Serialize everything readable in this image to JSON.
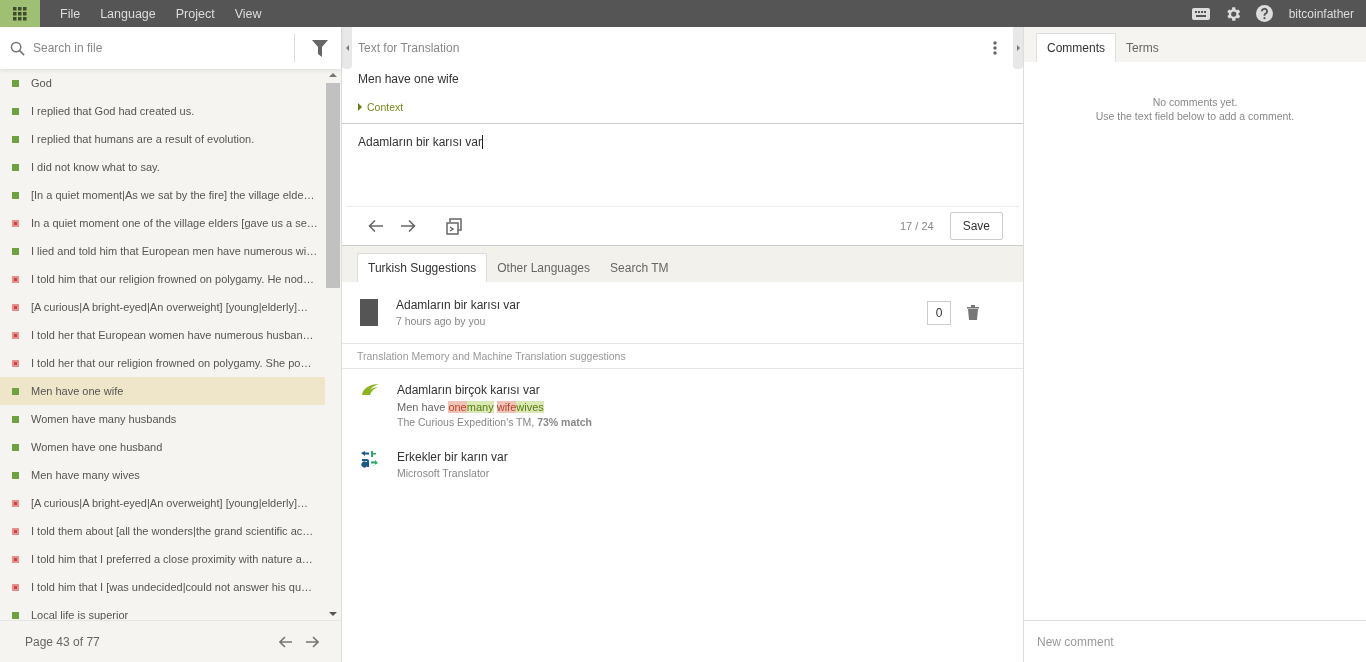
{
  "menu": [
    "File",
    "Language",
    "Project",
    "View"
  ],
  "user": "bitcoinfather",
  "search": {
    "placeholder": "Search in file"
  },
  "strings": [
    {
      "text": "God",
      "translated": true,
      "selected": false
    },
    {
      "text": "I replied that God had created us.",
      "translated": true,
      "selected": false
    },
    {
      "text": "I replied that humans are a result of evolution.",
      "translated": true,
      "selected": false
    },
    {
      "text": "I did not know what to say.",
      "translated": true,
      "selected": false
    },
    {
      "text": "[In a quiet moment|As we sat by the fire] the village elde…",
      "translated": true,
      "selected": false
    },
    {
      "text": "In a quiet moment one of the village elders [gave us a se…",
      "translated": false,
      "selected": false
    },
    {
      "text": "I lied and told him that European men have numerous wi…",
      "translated": true,
      "selected": false
    },
    {
      "text": "I told him that our religion frowned on polygamy. He nod…",
      "translated": false,
      "selected": false
    },
    {
      "text": "[A curious|A bright-eyed|An overweight] [young|elderly]…",
      "translated": false,
      "selected": false
    },
    {
      "text": "I told her that European women have numerous husban…",
      "translated": false,
      "selected": false
    },
    {
      "text": "I told her that our religion frowned on polygamy. She po…",
      "translated": false,
      "selected": false
    },
    {
      "text": "Men have one wife",
      "translated": true,
      "selected": true
    },
    {
      "text": "Women have many husbands",
      "translated": true,
      "selected": false
    },
    {
      "text": "Women have one husband",
      "translated": true,
      "selected": false
    },
    {
      "text": "Men have many wives",
      "translated": true,
      "selected": false
    },
    {
      "text": "[A curious|A bright-eyed|An overweight] [young|elderly]…",
      "translated": false,
      "selected": false
    },
    {
      "text": "I told them about [all the wonders|the grand scientific ac…",
      "translated": false,
      "selected": false
    },
    {
      "text": "I told him that I preferred a close proximity with nature a…",
      "translated": false,
      "selected": false
    },
    {
      "text": "I told him that I [was undecided|could not answer his qu…",
      "translated": false,
      "selected": false
    },
    {
      "text": "Local life is superior",
      "translated": true,
      "selected": false
    }
  ],
  "pager": "Page 43 of 77",
  "source": {
    "heading": "Text for Translation",
    "text": "Men have one wife",
    "context": "Context",
    "context_expanded": false
  },
  "translation": {
    "value": "Adamların bir karısı var",
    "counter": "17 / 24",
    "save": "Save"
  },
  "suggestion_tabs": [
    {
      "label": "Turkish Suggestions",
      "selected": true
    },
    {
      "label": "Other Languages",
      "selected": false
    },
    {
      "label": "Search TM",
      "selected": false
    }
  ],
  "own_suggestion": {
    "text": "Adamların bir karısı var",
    "meta": "7 hours ago by you",
    "votes": "0"
  },
  "tm_heading": "Translation Memory and Machine Translation suggestions",
  "tm_suggestions": [
    {
      "kind": "memory",
      "text": "Adamların birçok karısı var",
      "diff": [
        {
          "kind": "same",
          "text": "Men have"
        },
        {
          "kind": "change",
          "removed": "one",
          "added": "many"
        },
        {
          "kind": "change",
          "removed": "wife",
          "added": "wives"
        }
      ],
      "source": "The Curious Expedition's TM,",
      "match": "73% match"
    },
    {
      "kind": "machine",
      "text": "Erkekler bir karın var",
      "source": "Microsoft Translator"
    }
  ],
  "side_tabs": [
    {
      "label": "Comments",
      "selected": true
    },
    {
      "label": "Terms",
      "selected": false
    }
  ],
  "comments_empty": [
    "No comments yet.",
    "Use the text field below to add a comment."
  ],
  "comment": {
    "placeholder": "New comment"
  }
}
